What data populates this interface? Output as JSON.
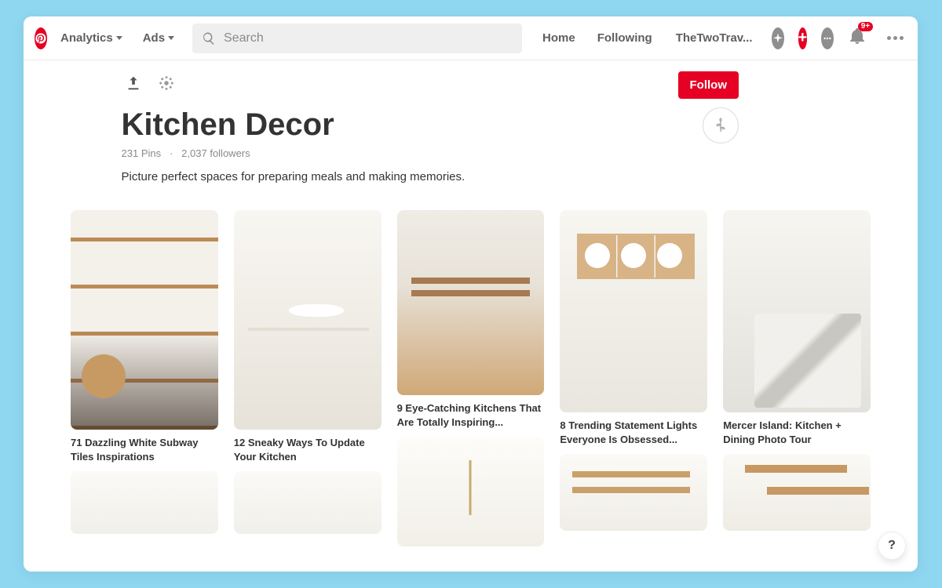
{
  "header": {
    "menus": [
      "Analytics",
      "Ads"
    ],
    "search_placeholder": "Search",
    "nav": [
      "Home",
      "Following"
    ],
    "username_trunc": "TheTwoTrav...",
    "notif_badge": "9+"
  },
  "board": {
    "follow_label": "Follow",
    "title": "Kitchen Decor",
    "pin_count": "231",
    "pin_count_suffix": "Pins",
    "followers": "2,037",
    "followers_suffix": "followers",
    "meta_sep": "·",
    "description": "Picture perfect spaces for preparing meals and making memories."
  },
  "pins": {
    "p1": "71 Dazzling White Subway Tiles Inspirations",
    "p2": "12 Sneaky Ways To Update Your Kitchen",
    "p3": "9 Eye-Catching Kitchens That Are Totally Inspiring...",
    "p4": "8 Trending Statement Lights Everyone Is Obsessed...",
    "p5": "Mercer Island: Kitchen + Dining Photo Tour"
  },
  "help_label": "?"
}
